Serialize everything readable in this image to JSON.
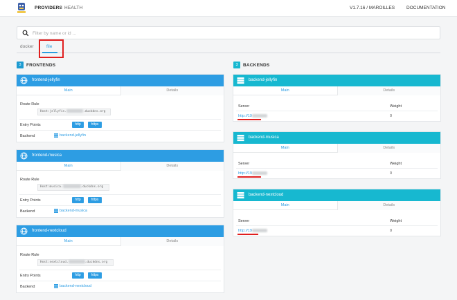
{
  "nav": {
    "providers": "PROVIDERS",
    "separator": "/",
    "health": "HEALTH",
    "version": "V1.7.16 / MAROILLES",
    "documentation": "DOCUMENTATION"
  },
  "search": {
    "placeholder": "Filter by name or id ..."
  },
  "provider_tabs": {
    "docker": "docker",
    "file": "file"
  },
  "frontends": {
    "count": "3",
    "title": "FRONTENDS",
    "tab_main": "Main",
    "tab_details": "Details",
    "route_rule_label": "Route Rule",
    "entry_points_label": "Entry Points",
    "backend_label": "Backend",
    "items": [
      {
        "name": "frontend-jellyfin",
        "rule_prefix": "Host:jellyfin.",
        "rule_suffix": ".duckdns.org",
        "ep1": "http",
        "ep2": "https",
        "backend": "backend-jellyfin"
      },
      {
        "name": "frontend-musica",
        "rule_prefix": "Host:musica.",
        "rule_suffix": ".duckdns.org",
        "ep1": "http",
        "ep2": "https",
        "backend": "backend-musica"
      },
      {
        "name": "frontend-nextcloud",
        "rule_prefix": "Host:nextcloud.",
        "rule_suffix": ".duckdns.org",
        "ep1": "http",
        "ep2": "https",
        "backend": "backend-nextcloud"
      }
    ]
  },
  "backends": {
    "count": "3",
    "title": "BACKENDS",
    "tab_main": "Main",
    "tab_details": "Details",
    "server_label": "Server",
    "weight_label": "Weight",
    "items": [
      {
        "name": "backend-jellyfin",
        "server": "http://19",
        "weight": "0"
      },
      {
        "name": "backend-musica",
        "server": "http://19",
        "weight": "0"
      },
      {
        "name": "backend-nextcloud",
        "server": "http://19",
        "weight": "0"
      }
    ]
  },
  "colors": {
    "accent": "#2d9de3",
    "teal": "#17b8d0",
    "highlight": "#e01e1e"
  }
}
